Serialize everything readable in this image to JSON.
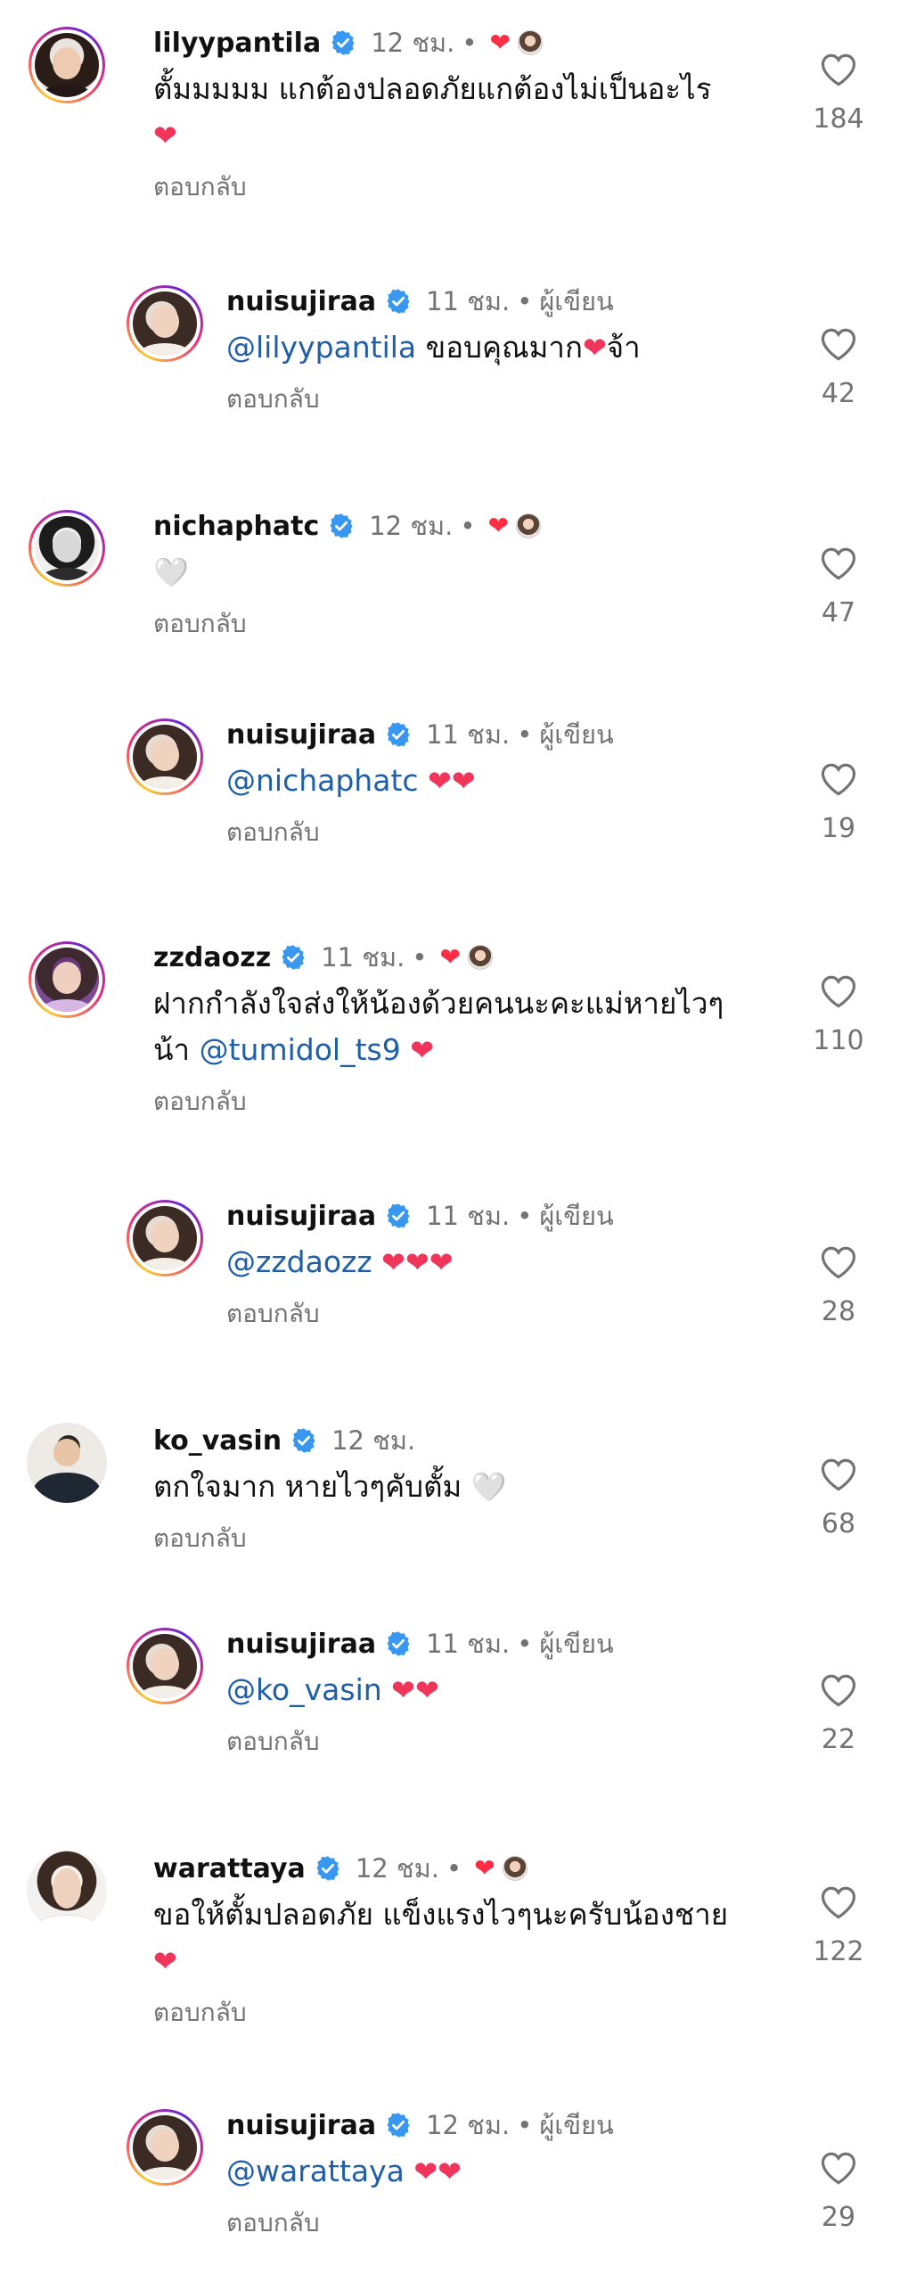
{
  "labels": {
    "reply": "ตอบกลับ",
    "author": "ผู้เขียน"
  },
  "colors": {
    "verified": "#3897f0",
    "heart": "#ff2d44",
    "mention": "#1f5fa9",
    "meta": "#737373"
  },
  "comments": [
    {
      "username": "lilyypantila",
      "time": "12 ชม.",
      "liked_by_author": true,
      "text": "ตั้มมมมม แกต้องปลอดภัยแกต้องไม่เป็นอะไร",
      "emoji": "❤",
      "emoji_style": "red",
      "likes": "184"
    },
    {
      "username": "nuisujiraa",
      "time": "11 ชม.",
      "is_author": true,
      "mention": "@lilyypantila",
      "text": " ขอบคุณมาก",
      "emoji": "❤",
      "emoji_style": "red",
      "text_after": "จ้า",
      "likes": "42"
    },
    {
      "username": "nichaphatc",
      "time": "12 ชม.",
      "liked_by_author": true,
      "emoji": "🤍",
      "emoji_style": "white",
      "likes": "47"
    },
    {
      "username": "nuisujiraa",
      "time": "11 ชม.",
      "is_author": true,
      "mention": "@nichaphatc",
      "emoji": "❤❤",
      "emoji_style": "red",
      "likes": "19"
    },
    {
      "username": "zzdaozz",
      "time": "11 ชม.",
      "liked_by_author": true,
      "text": "ฝากกำลังใจส่งให้น้องด้วยคนนะคะแม่หายไวๆน้า ",
      "mention_inline": "@tumidol_ts9",
      "emoji": "❤",
      "emoji_style": "red",
      "likes": "110"
    },
    {
      "username": "nuisujiraa",
      "time": "11 ชม.",
      "is_author": true,
      "mention": "@zzdaozz",
      "emoji": "❤❤❤",
      "emoji_style": "red",
      "likes": "28"
    },
    {
      "username": "ko_vasin",
      "time": "12 ชม.",
      "text": "ตกใจมาก หายไวๆคับตั้ม ",
      "emoji": "🤍",
      "emoji_style": "white",
      "likes": "68"
    },
    {
      "username": "nuisujiraa",
      "time": "11 ชม.",
      "is_author": true,
      "mention": "@ko_vasin",
      "emoji": "❤❤",
      "emoji_style": "red",
      "likes": "22"
    },
    {
      "username": "warattaya",
      "time": "12 ชม.",
      "liked_by_author": true,
      "text": "ขอให้ตั้มปลอดภัย แข็งแรงไวๆนะครับน้องชาย ",
      "emoji": "❤",
      "emoji_style": "red",
      "likes": "122"
    },
    {
      "username": "nuisujiraa",
      "time": "12 ชม.",
      "is_author": true,
      "mention": "@warattaya",
      "emoji": "❤❤",
      "emoji_style": "red",
      "likes": "29"
    }
  ]
}
